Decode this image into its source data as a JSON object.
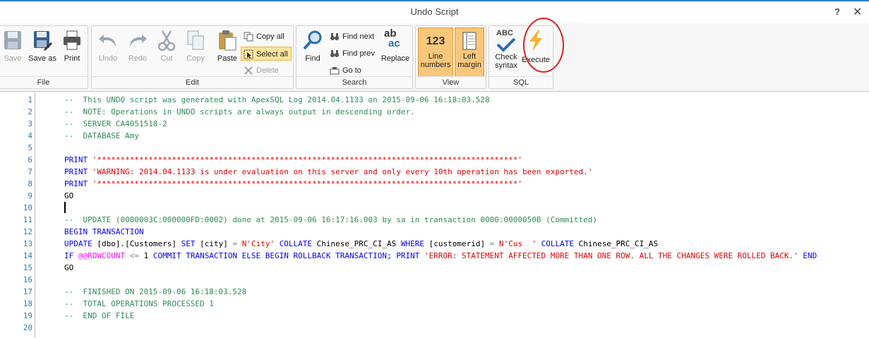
{
  "window": {
    "title": "Undo Script",
    "help_label": "?",
    "close_label": "✕"
  },
  "ribbon": {
    "file": {
      "label": "File",
      "save": "Save",
      "save_as": "Save as",
      "print": "Print"
    },
    "edit": {
      "label": "Edit",
      "undo": "Undo",
      "redo": "Redo",
      "cut": "Cut",
      "copy": "Copy",
      "paste": "Paste",
      "copy_all": "Copy all",
      "select_all": "Select all",
      "delete": "Delete"
    },
    "search": {
      "label": "Search",
      "find": "Find",
      "find_next": "Find next",
      "find_prev": "Find prev",
      "go_to": "Go to",
      "replace": "Replace",
      "replace_icon_top": "ab",
      "replace_icon_bottom": "ac"
    },
    "view": {
      "label": "View",
      "line_numbers_icon": "123",
      "line_numbers_1": "Line",
      "line_numbers_2": "numbers",
      "left_margin_1": "Left",
      "left_margin_2": "margin"
    },
    "sql": {
      "label": "SQL",
      "check_icon_text": "ABC",
      "check_syntax_1": "Check",
      "check_syntax_2": "syntax",
      "execute": "Execute"
    }
  },
  "editor": {
    "line_numbers": [
      "1",
      "2",
      "3",
      "4",
      "5",
      "6",
      "7",
      "8",
      "9",
      "10",
      "11",
      "12",
      "13",
      "14",
      "15",
      "16",
      "17",
      "18",
      "19",
      "20"
    ],
    "lines": {
      "l1": "--  This UNDO script was generated with ApexSQL Log 2014.04.1133 on 2015-09-06 16:18:03.528",
      "l2": "--  NOTE: Operations in UNDO scripts are always output in descending order.",
      "l3": "--  SERVER CA4051518-2",
      "l4": "--  DATABASE Amy",
      "print_kw": "PRINT",
      "stars": "'******************************************************************************************'",
      "l7_str": "'WARNING: 2014.04.1133 is under evaluation on this server and only every 10th operation has been exported.'",
      "go": "GO",
      "l11": "--  UPDATE (0000003C:000000FD:0002) done at 2015-09-06 16:17:16.003 by sa in transaction 0000:0000050B (Committed)",
      "l12": "BEGIN TRANSACTION",
      "l13_update": "UPDATE",
      "l13_table": " [dbo].[Customers] ",
      "l13_set": "SET",
      "l13_col": " [city] ",
      "l13_eq": "=",
      "l13_val": " N'City' ",
      "l13_collate": "COLLATE",
      "l13_coll": " Chinese_PRC_CI_AS ",
      "l13_where": "WHERE",
      "l13_wcol": " [customerid] ",
      "l13_eq2": "=",
      "l13_wval": " N'Cus  ' ",
      "l13_collate2": "COLLATE",
      "l13_coll2": " Chinese_PRC_CI_AS",
      "l14_if": "IF ",
      "l14_rc": "@@ROWCOUNT",
      "l14_le": " <= ",
      "l14_one": "1",
      "l14_commit": " COMMIT TRANSACTION ELSE BEGIN ROLLBACK TRANSACTION; PRINT ",
      "l14_err": "'ERROR: STATEMENT AFFECTED MORE THAN ONE ROW. ALL THE CHANGES WERE ROLLED BACK.'",
      "l14_end": " END",
      "l17": "--  FINISHED ON 2015-09-06 16:18:03.528",
      "l18": "--  TOTAL OPERATIONS PROCESSED 1",
      "l19": "--  END OF FILE"
    }
  }
}
